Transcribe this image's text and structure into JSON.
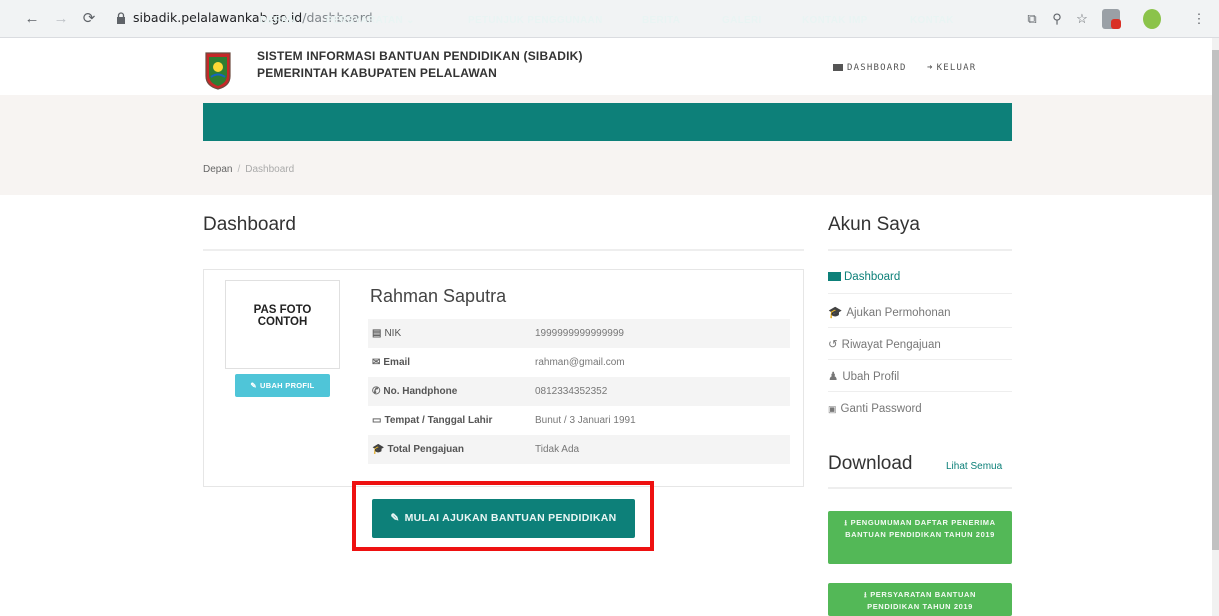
{
  "browser": {
    "url_host": "sibadik.pelalawankab.go.id",
    "url_path": "/dashboard"
  },
  "site": {
    "title_line1": "SISTEM INFORMASI BANTUAN PENDIDIKAN (SIBADIK)",
    "title_line2": "PEMERINTAH KABUPATEN PELALAWAN",
    "header_links": [
      "DASHBOARD",
      "KELUAR"
    ]
  },
  "menu": {
    "items": [
      "DEPAN",
      "PERSYARATAN ⌄",
      "PETUNJUK PENGGUNAAN",
      "BERITA",
      "GALERI",
      "KONTAK IMP",
      "KONTAK"
    ]
  },
  "breadcrumb": {
    "home": "Depan",
    "current": "Dashboard"
  },
  "main": {
    "heading": "Dashboard",
    "photo_text": "PAS FOTO CONTOH",
    "edit_profile_label": "UBAH PROFIL",
    "name": "Rahman Saputra",
    "rows": [
      {
        "label": "NIK",
        "value": "1999999999999999"
      },
      {
        "label": "Email",
        "value": "rahman@gmail.com"
      },
      {
        "label": "No. Handphone",
        "value": "0812334352352"
      },
      {
        "label": "Tempat / Tanggal Lahir",
        "value": "Bunut / 3 Januari 1991"
      },
      {
        "label": "Total Pengajuan",
        "value": "Tidak Ada"
      }
    ],
    "cta_label": "MULAI AJUKAN BANTUAN PENDIDIKAN"
  },
  "sidebar": {
    "heading": "Akun Saya",
    "items": [
      "Dashboard",
      "Ajukan Permohonan",
      "Riwayat Pengajuan",
      "Ubah Profil",
      "Ganti Password"
    ],
    "download_heading": "Download",
    "see_all": "Lihat Semua",
    "downloads": [
      "PENGUMUMAN DAFTAR PENERIMA BANTUAN PENDIDIKAN TAHUN 2019",
      "PERSYARATAN BANTUAN PENDIDIKAN TAHUN 2019"
    ]
  },
  "colors": {
    "primary": "#0d8079",
    "download": "#53b857",
    "highlight": "#ee1111",
    "info": "#4fc5d8"
  }
}
